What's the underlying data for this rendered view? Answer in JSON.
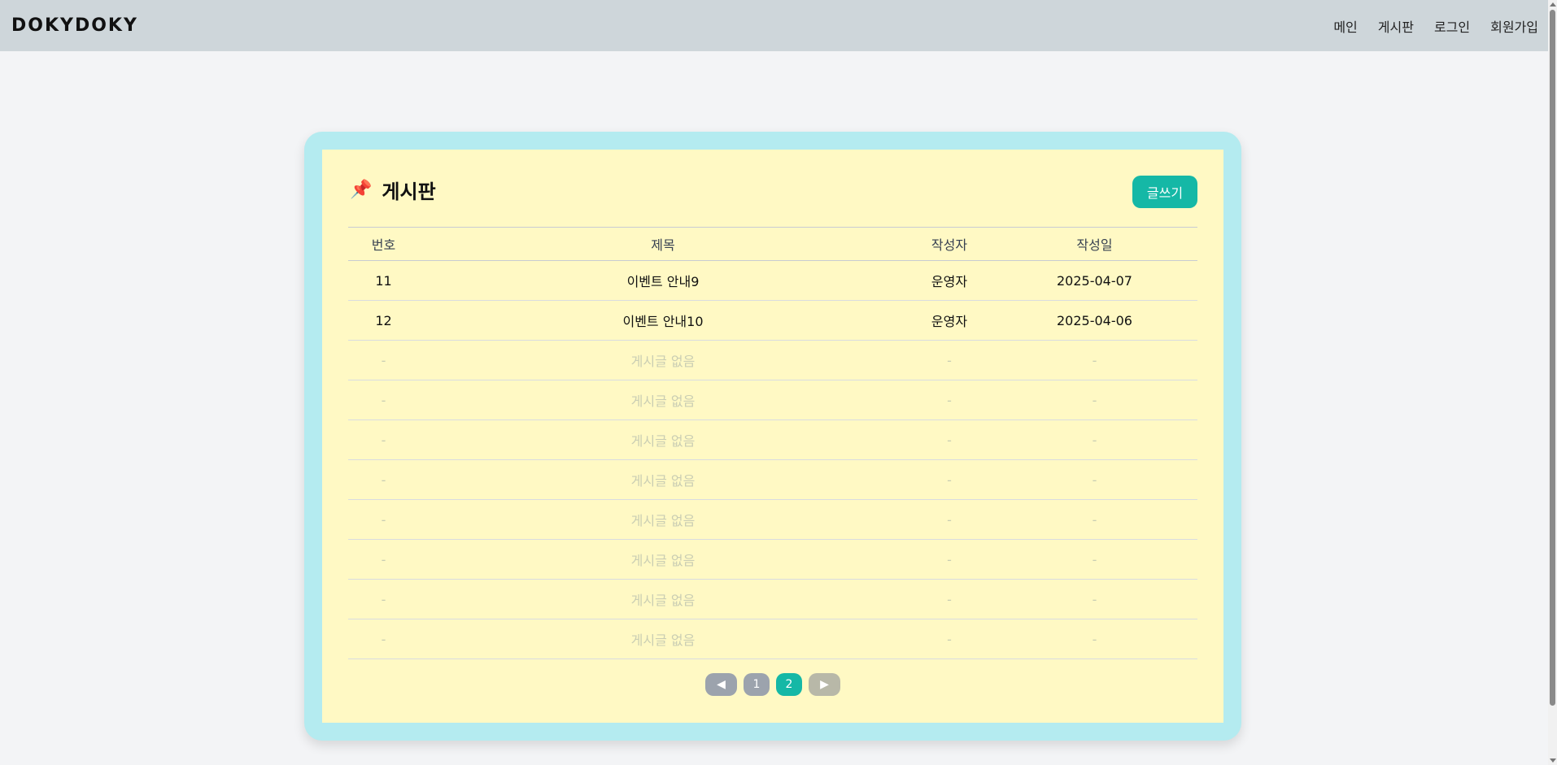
{
  "header": {
    "logo": "DOKYDOKY",
    "nav": [
      "메인",
      "게시판",
      "로그인",
      "회원가입"
    ]
  },
  "board": {
    "icon": "📌",
    "title": "게시판",
    "write_label": "글쓰기",
    "columns": [
      "번호",
      "제목",
      "작성자",
      "작성일"
    ],
    "rows": [
      [
        "11",
        "이벤트 안내9",
        "운영자",
        "2025-04-07"
      ],
      [
        "12",
        "이벤트 안내10",
        "운영자",
        "2025-04-06"
      ],
      [
        "-",
        "게시글 없음",
        "-",
        "-"
      ],
      [
        "-",
        "게시글 없음",
        "-",
        "-"
      ],
      [
        "-",
        "게시글 없음",
        "-",
        "-"
      ],
      [
        "-",
        "게시글 없음",
        "-",
        "-"
      ],
      [
        "-",
        "게시글 없음",
        "-",
        "-"
      ],
      [
        "-",
        "게시글 없음",
        "-",
        "-"
      ],
      [
        "-",
        "게시글 없음",
        "-",
        "-"
      ],
      [
        "-",
        "게시글 없음",
        "-",
        "-"
      ]
    ]
  },
  "pagination": {
    "prev": "◀",
    "pages": [
      "1",
      "2"
    ],
    "current_page": "2",
    "next": "▶"
  },
  "colors": {
    "header_bg": "#ced6da",
    "card_outer": "#b4ebf0",
    "card_inner": "#fff9c4",
    "accent": "#15b8a6"
  }
}
